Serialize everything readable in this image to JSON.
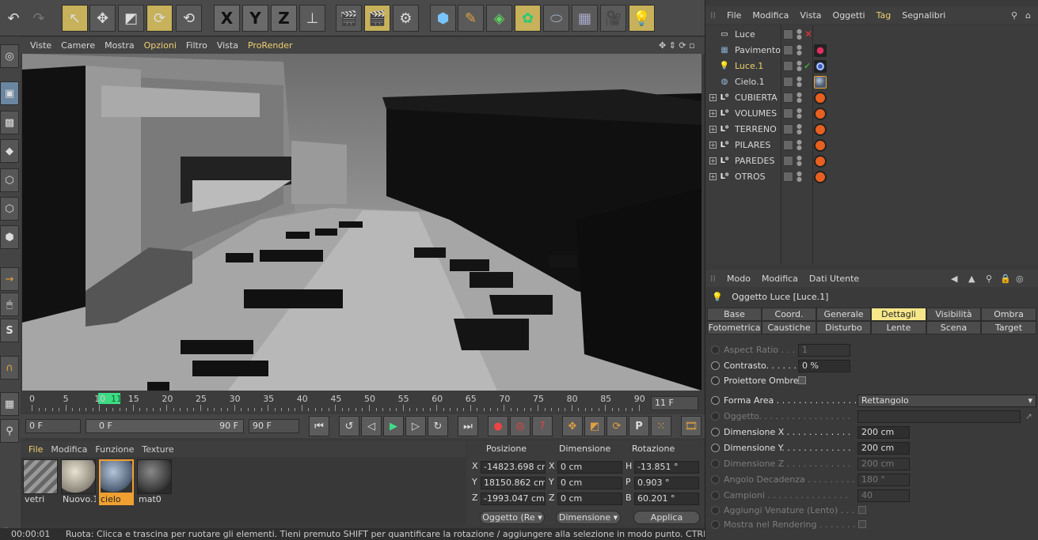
{
  "colors": {
    "accent": "#f0d070",
    "active_tab": "#f5e68a",
    "frame_marker": "#3ddc84"
  },
  "viewport_menu": [
    "Viste",
    "Camere",
    "Mostra",
    "Opzioni",
    "Filtro",
    "Vista",
    "ProRender"
  ],
  "viewport_menu_highlight": [
    3,
    6
  ],
  "timeline": {
    "ticks": [
      "0",
      "5",
      "10",
      "15",
      "20",
      "25",
      "30",
      "35",
      "40",
      "45",
      "50",
      "55",
      "60",
      "65",
      "70",
      "75",
      "80",
      "85",
      "90"
    ],
    "current_frame": "11",
    "frame_readout": "11 F"
  },
  "transport": {
    "start_field": "0 F",
    "range_start": "0 F",
    "range_end": "90 F",
    "end_field": "90 F"
  },
  "material_menu": [
    "File",
    "Modifica",
    "Funzione",
    "Texture"
  ],
  "materials": [
    {
      "name": "vetri",
      "selected": false
    },
    {
      "name": "Nuovo.1",
      "selected": false
    },
    {
      "name": "cielo",
      "selected": true
    },
    {
      "name": "mat0",
      "selected": false
    }
  ],
  "coords": {
    "headers": [
      "Posizione",
      "Dimensione",
      "Rotazione"
    ],
    "rows": [
      {
        "axis": "X",
        "pos": "-14823.698 cr",
        "daxis": "X",
        "dim": "0 cm",
        "raxis": "H",
        "rot": "-13.851 °"
      },
      {
        "axis": "Y",
        "pos": "18150.862 cm",
        "daxis": "Y",
        "dim": "0 cm",
        "raxis": "P",
        "rot": "0.903 °"
      },
      {
        "axis": "Z",
        "pos": "-1993.047 cm",
        "daxis": "Z",
        "dim": "0 cm",
        "raxis": "B",
        "rot": "60.201 °"
      }
    ],
    "mode_select": "Oggetto (Re",
    "dim_select": "Dimensione",
    "apply": "Applica"
  },
  "status": {
    "time": "00:00:01",
    "text": "Ruota: Clicca e trascina per ruotare gli elementi. Tieni premuto SHIFT per quantificare la rotazione / aggiungere alla selezione in modo punto. CTRL per rimuove"
  },
  "object_menu": [
    "File",
    "Modifica",
    "Vista",
    "Oggetti",
    "Tag",
    "Segnalibri"
  ],
  "objects": [
    {
      "name": "Luce",
      "icon": "light",
      "expand": false,
      "selected": false,
      "tag": "none"
    },
    {
      "name": "Pavimento",
      "icon": "floor",
      "expand": false,
      "selected": false,
      "tag": "pink"
    },
    {
      "name": "Luce.1",
      "icon": "light",
      "expand": false,
      "selected": true,
      "tag": "target"
    },
    {
      "name": "Cielo.1",
      "icon": "sky",
      "expand": false,
      "selected": false,
      "tag": "sphere"
    },
    {
      "name": "CUBIERTA",
      "icon": "null",
      "expand": true,
      "selected": false,
      "tag": "compositing"
    },
    {
      "name": "VOLUMES",
      "icon": "null",
      "expand": true,
      "selected": false,
      "tag": "compositing"
    },
    {
      "name": "TERRENO",
      "icon": "null",
      "expand": true,
      "selected": false,
      "tag": "compositing"
    },
    {
      "name": "PILARES",
      "icon": "null",
      "expand": true,
      "selected": false,
      "tag": "compositing"
    },
    {
      "name": "PAREDES",
      "icon": "null",
      "expand": true,
      "selected": false,
      "tag": "compositing"
    },
    {
      "name": "OTROS",
      "icon": "null",
      "expand": true,
      "selected": false,
      "tag": "compositing"
    }
  ],
  "attr_menu": [
    "Modo",
    "Modifica",
    "Dati Utente"
  ],
  "attr_title": "Oggetto Luce [Luce.1]",
  "tabs_row1": [
    "Base",
    "Coord.",
    "Generale",
    "Dettagli",
    "Visibilità",
    "Ombra"
  ],
  "tabs_row2": [
    "Fotometrica",
    "Caustiche",
    "Disturbo",
    "Lente",
    "Scena",
    "Target"
  ],
  "active_tab": "Dettagli",
  "attributes": [
    {
      "label": "Aspect Ratio . . . . .",
      "value": "1",
      "dim": true,
      "type": "field"
    },
    {
      "label": "Contrasto. . . . . . .",
      "value": "0 %",
      "dim": false,
      "type": "field"
    },
    {
      "label": "Proiettore Ombre",
      "value": "",
      "dim": false,
      "type": "check"
    },
    {
      "label": "Forma Area . . . . . . . . . . . . . . .",
      "value": "Rettangolo",
      "dim": false,
      "type": "select"
    },
    {
      "label": "Oggetto. . . . . . . . . . . . . . . . .",
      "value": "",
      "dim": true,
      "type": "link"
    },
    {
      "label": "Dimensione X . . . . . . . . . . . .",
      "value": "200 cm",
      "dim": false,
      "type": "field"
    },
    {
      "label": "Dimensione Y. . . . . . . . . . . . .",
      "value": "200 cm",
      "dim": false,
      "type": "field"
    },
    {
      "label": "Dimensione Z . . . . . . . . . . . .",
      "value": "200 cm",
      "dim": true,
      "type": "field"
    },
    {
      "label": "Angolo Decadenza . . . . . . . . .",
      "value": "180 °",
      "dim": true,
      "type": "field"
    },
    {
      "label": "Campioni . . . . . . . . . . . . . . .",
      "value": "40",
      "dim": true,
      "type": "field"
    },
    {
      "label": "Aggiungi Venature (Lento) . . . .",
      "value": "",
      "dim": true,
      "type": "check"
    },
    {
      "label": "Mostra nel Rendering . . . . . . .",
      "value": "",
      "dim": true,
      "type": "check"
    }
  ]
}
